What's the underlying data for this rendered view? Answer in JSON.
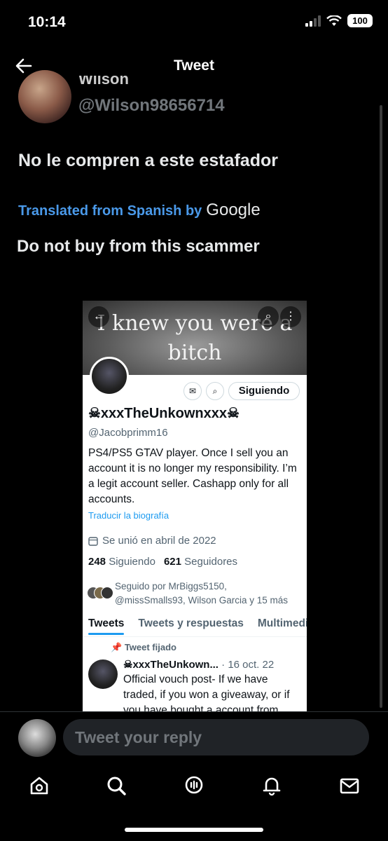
{
  "status_bar": {
    "time": "10:14",
    "battery": "100"
  },
  "header": {
    "title": "Tweet"
  },
  "author": {
    "name_partial": "Wilson",
    "handle": "@Wilson98656714"
  },
  "tweet": {
    "text": "No le compren a este estafador",
    "translated_label": "Translated from Spanish by",
    "translator": "Google",
    "translation": "Do not buy from this scammer"
  },
  "embedded_profile": {
    "banner_text": "I knew you were a bitch",
    "back_glyph": "←",
    "search_glyph": "⌕",
    "more_glyph": "⋮",
    "mail_glyph": "✉",
    "bell_glyph": "⌕",
    "follow_button": "Siguiendo",
    "name": "☠xxxTheUnkownxxx☠",
    "handle": "@Jacobprimm16",
    "bio": "PS4/PS5 GTAV player. Once I sell you an account it is no longer my responsibility. I’m a legit account seller. Cashapp only for all accounts.",
    "translate_bio": "Traducir la biografía",
    "joined": "Se unió en abril de 2022",
    "following_count": "248",
    "following_label": "Siguiendo",
    "followers_count": "621",
    "followers_label": "Seguidores",
    "followed_by_line1": "Seguido por MrBiggs5150,",
    "followed_by_line2": "@missSmalls93, Wilson Garcia y 15 más",
    "tabs": [
      "Tweets",
      "Tweets y respuestas",
      "Multimedia"
    ],
    "pinned_label": "Tweet fijado",
    "pinned_name": "☠xxxTheUnkown...",
    "pinned_date": "· 16 oct. 22",
    "pinned_text": "Official vouch post- If we have traded, if you won a giveaway, or if you have bought a account from"
  },
  "reply": {
    "placeholder": "Tweet your reply"
  },
  "nav": {
    "icons": [
      "home-icon",
      "search-icon",
      "spaces-icon",
      "notifications-icon",
      "messages-icon"
    ]
  }
}
